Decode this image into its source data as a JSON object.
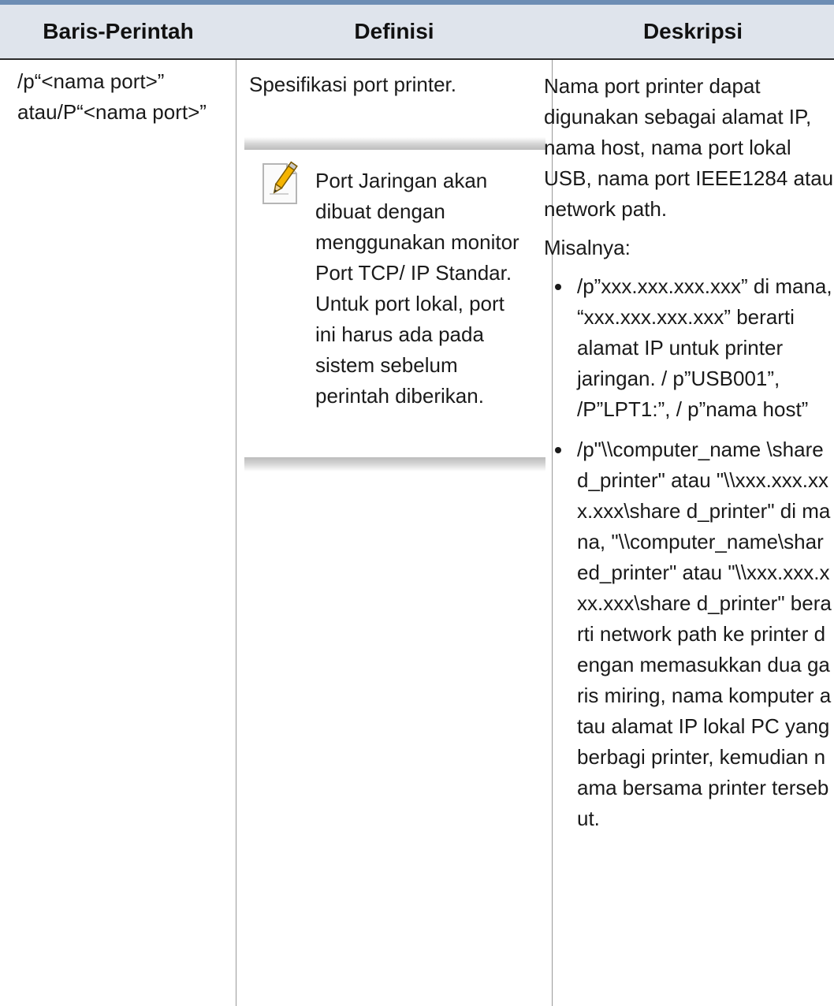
{
  "table": {
    "headers": [
      "Baris-Perintah",
      "Definisi",
      "Deskripsi"
    ],
    "row": {
      "command": "/p“<nama port>” atau/P“<nama port>”",
      "definition": "Spesifikasi port printer.",
      "note": {
        "icon": "note-pencil-icon",
        "text": "Port Jaringan akan dibuat dengan menggunakan monitor Port TCP/ IP Standar. Untuk port lokal, port ini harus ada pada sistem sebelum perintah diberikan."
      },
      "description": {
        "intro": "Nama port printer dapat digunakan sebagai alamat IP, nama host, nama port lokal USB, nama port IEEE1284 atau network path.",
        "example_label": "Misalnya:",
        "bullets": [
          "/p”xxx.xxx.xxx.xxx” di mana, “xxx.xxx.xxx.xxx” berarti alamat IP untuk printer jaringan. / p”USB001”, /P”LPT1:”, / p”nama host”",
          "/p\"\\\\computer_name \\shared_printer\" atau \"\\\\xxx.xxx.xxx.xxx\\share d_printer\" di mana, \"\\\\computer_name\\shar ed_printer\" atau \"\\\\xxx.xxx.xxx.xxx\\share d_printer\" berarti network path ke printer dengan memasukkan dua garis miring, nama komputer atau alamat IP lokal PC yang berbagi printer, kemudian nama bersama printer tersebut."
        ]
      }
    }
  },
  "colors": {
    "top_bar": "#6d8db4",
    "header_bg": "#dfe4ec",
    "pencil": "#f5b400"
  }
}
